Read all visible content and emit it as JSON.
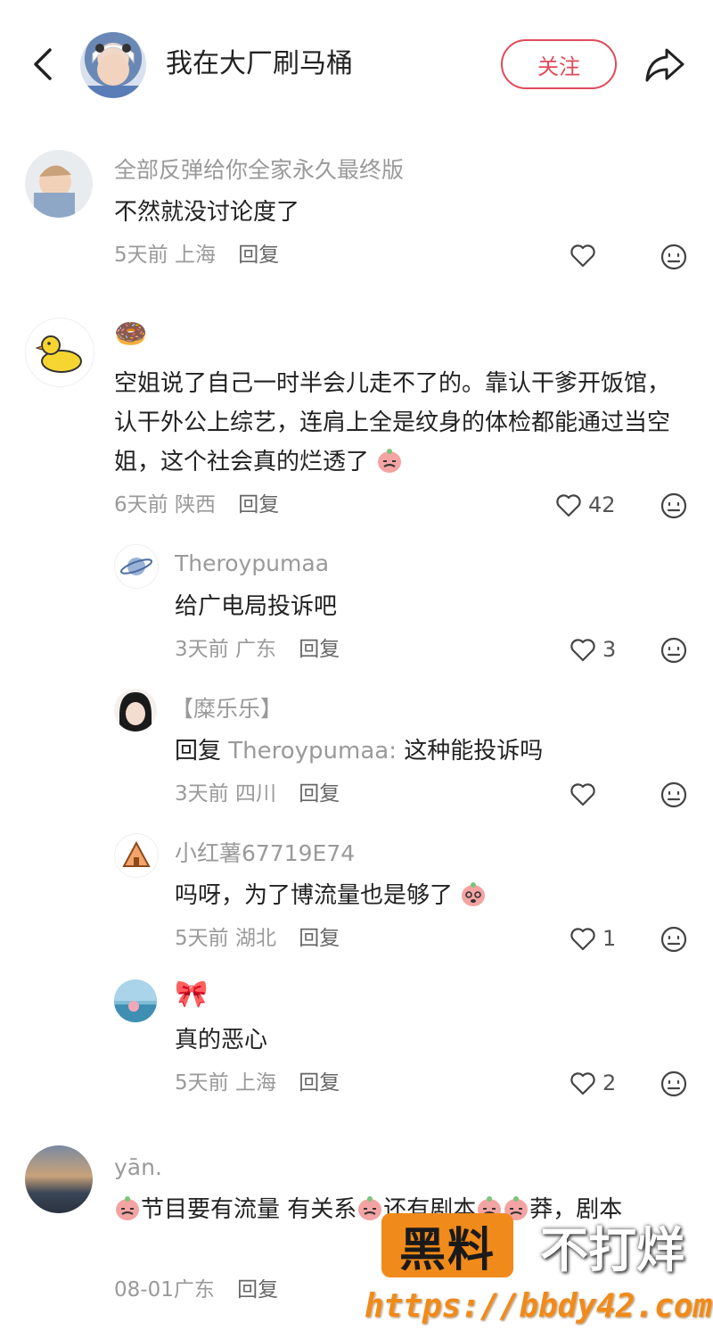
{
  "header": {
    "title": "我在大厂刷马桶",
    "follow_label": "关注"
  },
  "comments": [
    {
      "user": "全部反弹给你全家永久最终版",
      "text": "不然就没讨论度了",
      "time": "5天前",
      "location": "上海",
      "reply": "回复",
      "likes": ""
    },
    {
      "user": "🍩",
      "text": "空姐说了自己一时半会儿走不了的。靠认干爹开饭馆，认干外公上综艺，连肩上全是纹身的体检都能通过当空姐，这个社会真的烂透了",
      "time": "6天前",
      "location": "陕西",
      "reply": "回复",
      "likes": "42"
    },
    {
      "user": "Theroypumaa",
      "text": "给广电局投诉吧",
      "time": "3天前",
      "location": "广东",
      "reply": "回复",
      "likes": "3"
    },
    {
      "user": "【糜乐乐】",
      "reply_prefix": "回复",
      "reply_to": "Theroypumaa:",
      "text": "这种能投诉吗",
      "time": "3天前",
      "location": "四川",
      "reply": "回复",
      "likes": ""
    },
    {
      "user": "小红薯67719E74",
      "text": "吗呀，为了博流量也是够了",
      "time": "5天前",
      "location": "湖北",
      "reply": "回复",
      "likes": "1"
    },
    {
      "user": "🎀",
      "text": "真的恶心",
      "time": "5天前",
      "location": "上海",
      "reply": "回复",
      "likes": "2"
    },
    {
      "user": "yān.",
      "text_part1": "节目要有流量 有关系",
      "text_part2": "还有剧本",
      "text_part3": "莽，剧本",
      "time": "08-01",
      "location": "广东",
      "reply": "回复"
    }
  ],
  "watermark": {
    "part1": "黑料",
    "part2": "不打烊",
    "url": "https://bbdy42.com"
  },
  "colors": {
    "accent": "#e04a5a",
    "watermark": "#f08a1a"
  },
  "icons": [
    "back-arrow-icon",
    "share-icon",
    "heart-icon",
    "emoji-reaction-icon",
    "crying-emoji-icon"
  ]
}
